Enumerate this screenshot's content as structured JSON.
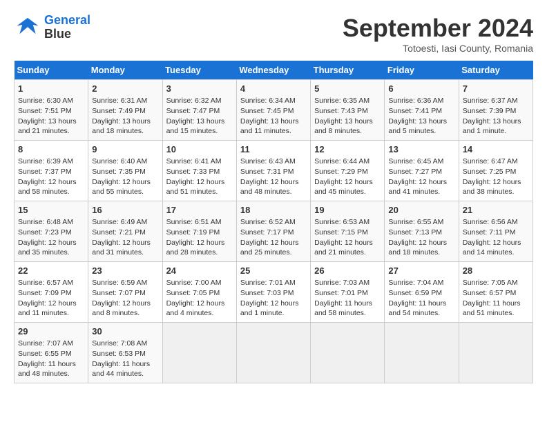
{
  "logo": {
    "line1": "General",
    "line2": "Blue"
  },
  "title": "September 2024",
  "location": "Totoesti, Iasi County, Romania",
  "days_header": [
    "Sunday",
    "Monday",
    "Tuesday",
    "Wednesday",
    "Thursday",
    "Friday",
    "Saturday"
  ],
  "weeks": [
    [
      {
        "num": "1",
        "sunrise": "6:30 AM",
        "sunset": "7:51 PM",
        "daylight": "13 hours and 21 minutes."
      },
      {
        "num": "2",
        "sunrise": "6:31 AM",
        "sunset": "7:49 PM",
        "daylight": "13 hours and 18 minutes."
      },
      {
        "num": "3",
        "sunrise": "6:32 AM",
        "sunset": "7:47 PM",
        "daylight": "13 hours and 15 minutes."
      },
      {
        "num": "4",
        "sunrise": "6:34 AM",
        "sunset": "7:45 PM",
        "daylight": "13 hours and 11 minutes."
      },
      {
        "num": "5",
        "sunrise": "6:35 AM",
        "sunset": "7:43 PM",
        "daylight": "13 hours and 8 minutes."
      },
      {
        "num": "6",
        "sunrise": "6:36 AM",
        "sunset": "7:41 PM",
        "daylight": "13 hours and 5 minutes."
      },
      {
        "num": "7",
        "sunrise": "6:37 AM",
        "sunset": "7:39 PM",
        "daylight": "13 hours and 1 minute."
      }
    ],
    [
      {
        "num": "8",
        "sunrise": "6:39 AM",
        "sunset": "7:37 PM",
        "daylight": "12 hours and 58 minutes."
      },
      {
        "num": "9",
        "sunrise": "6:40 AM",
        "sunset": "7:35 PM",
        "daylight": "12 hours and 55 minutes."
      },
      {
        "num": "10",
        "sunrise": "6:41 AM",
        "sunset": "7:33 PM",
        "daylight": "12 hours and 51 minutes."
      },
      {
        "num": "11",
        "sunrise": "6:43 AM",
        "sunset": "7:31 PM",
        "daylight": "12 hours and 48 minutes."
      },
      {
        "num": "12",
        "sunrise": "6:44 AM",
        "sunset": "7:29 PM",
        "daylight": "12 hours and 45 minutes."
      },
      {
        "num": "13",
        "sunrise": "6:45 AM",
        "sunset": "7:27 PM",
        "daylight": "12 hours and 41 minutes."
      },
      {
        "num": "14",
        "sunrise": "6:47 AM",
        "sunset": "7:25 PM",
        "daylight": "12 hours and 38 minutes."
      }
    ],
    [
      {
        "num": "15",
        "sunrise": "6:48 AM",
        "sunset": "7:23 PM",
        "daylight": "12 hours and 35 minutes."
      },
      {
        "num": "16",
        "sunrise": "6:49 AM",
        "sunset": "7:21 PM",
        "daylight": "12 hours and 31 minutes."
      },
      {
        "num": "17",
        "sunrise": "6:51 AM",
        "sunset": "7:19 PM",
        "daylight": "12 hours and 28 minutes."
      },
      {
        "num": "18",
        "sunrise": "6:52 AM",
        "sunset": "7:17 PM",
        "daylight": "12 hours and 25 minutes."
      },
      {
        "num": "19",
        "sunrise": "6:53 AM",
        "sunset": "7:15 PM",
        "daylight": "12 hours and 21 minutes."
      },
      {
        "num": "20",
        "sunrise": "6:55 AM",
        "sunset": "7:13 PM",
        "daylight": "12 hours and 18 minutes."
      },
      {
        "num": "21",
        "sunrise": "6:56 AM",
        "sunset": "7:11 PM",
        "daylight": "12 hours and 14 minutes."
      }
    ],
    [
      {
        "num": "22",
        "sunrise": "6:57 AM",
        "sunset": "7:09 PM",
        "daylight": "12 hours and 11 minutes."
      },
      {
        "num": "23",
        "sunrise": "6:59 AM",
        "sunset": "7:07 PM",
        "daylight": "12 hours and 8 minutes."
      },
      {
        "num": "24",
        "sunrise": "7:00 AM",
        "sunset": "7:05 PM",
        "daylight": "12 hours and 4 minutes."
      },
      {
        "num": "25",
        "sunrise": "7:01 AM",
        "sunset": "7:03 PM",
        "daylight": "12 hours and 1 minute."
      },
      {
        "num": "26",
        "sunrise": "7:03 AM",
        "sunset": "7:01 PM",
        "daylight": "11 hours and 58 minutes."
      },
      {
        "num": "27",
        "sunrise": "7:04 AM",
        "sunset": "6:59 PM",
        "daylight": "11 hours and 54 minutes."
      },
      {
        "num": "28",
        "sunrise": "7:05 AM",
        "sunset": "6:57 PM",
        "daylight": "11 hours and 51 minutes."
      }
    ],
    [
      {
        "num": "29",
        "sunrise": "7:07 AM",
        "sunset": "6:55 PM",
        "daylight": "11 hours and 48 minutes."
      },
      {
        "num": "30",
        "sunrise": "7:08 AM",
        "sunset": "6:53 PM",
        "daylight": "11 hours and 44 minutes."
      },
      null,
      null,
      null,
      null,
      null
    ]
  ]
}
